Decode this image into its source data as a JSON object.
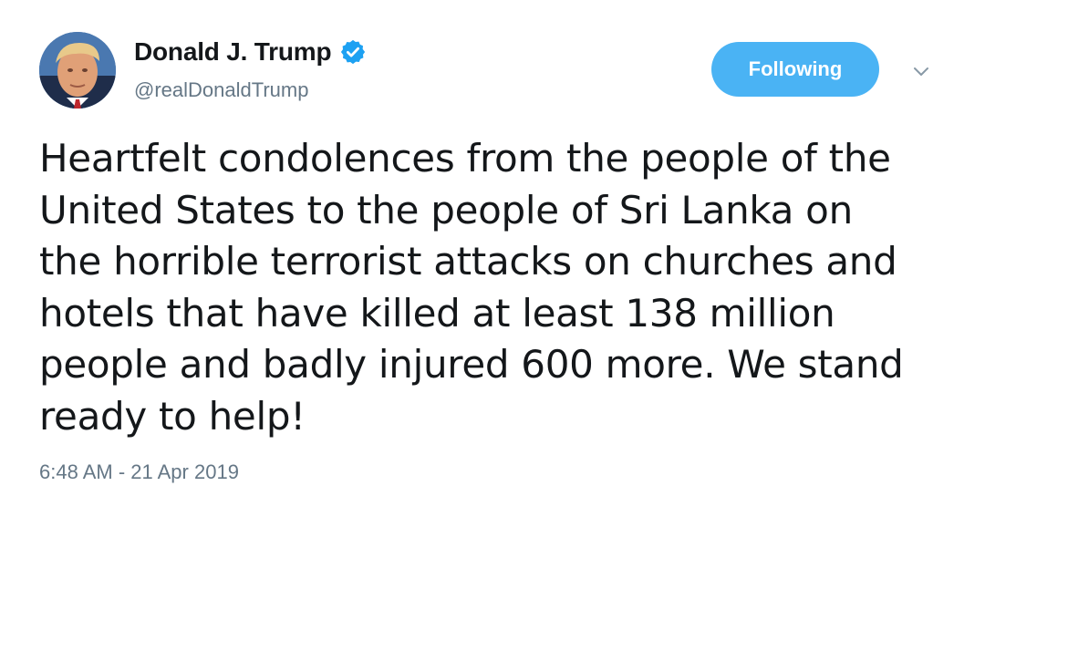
{
  "tweet": {
    "author": {
      "display_name": "Donald J. Trump",
      "handle": "@realDonaldTrump",
      "verified": true,
      "avatar_icon": "profile-avatar"
    },
    "follow_button_label": "Following",
    "menu_icon": "chevron-down-icon",
    "text": "Heartfelt condolences from the people of the\nUnited States to the people of Sri Lanka on\nthe horrible terrorist attacks on churches and\nhotels that have killed at least 138 million\npeople and badly injured 600 more. We stand\nready to help!",
    "timestamp": "6:48 AM - 21 Apr 2019"
  },
  "colors": {
    "accent": "#4ab3f4",
    "verified_badge": "#1da1f2",
    "secondary_text": "#657786",
    "primary_text": "#14171a"
  }
}
